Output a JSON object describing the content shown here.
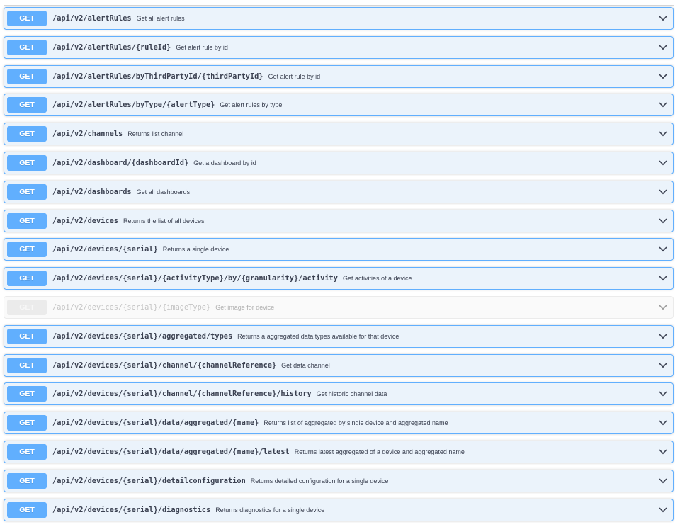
{
  "accent": "#61affe",
  "operations": [
    {
      "method": "GET",
      "path": "/api/v2/alertRules",
      "summary": "Get all alert rules"
    },
    {
      "method": "GET",
      "path": "/api/v2/alertRules/{ruleId}",
      "summary": "Get alert rule by id"
    },
    {
      "method": "GET",
      "path": "/api/v2/alertRules/byThirdPartyId/{thirdPartyId}",
      "summary": "Get alert rule by id"
    },
    {
      "method": "GET",
      "path": "/api/v2/alertRules/byType/{alertType}",
      "summary": "Get alert rules by type"
    },
    {
      "method": "GET",
      "path": "/api/v2/channels",
      "summary": "Returns list channel"
    },
    {
      "method": "GET",
      "path": "/api/v2/dashboard/{dashboardId}",
      "summary": "Get a dashboard by id"
    },
    {
      "method": "GET",
      "path": "/api/v2/dashboards",
      "summary": "Get all dashboards"
    },
    {
      "method": "GET",
      "path": "/api/v2/devices",
      "summary": "Returns the list of all devices"
    },
    {
      "method": "GET",
      "path": "/api/v2/devices/{serial}",
      "summary": "Returns a single device"
    },
    {
      "method": "GET",
      "path": "/api/v2/devices/{serial}/{activityType}/by/{granularity}/activity",
      "summary": "Get activities of a device"
    },
    {
      "method": "GET",
      "path": "/api/v2/devices/{serial}/{imageType}",
      "summary": "Get image for device",
      "deprecated": true
    },
    {
      "method": "GET",
      "path": "/api/v2/devices/{serial}/aggregated/types",
      "summary": "Returns a aggregated data types available for that device"
    },
    {
      "method": "GET",
      "path": "/api/v2/devices/{serial}/channel/{channelReference}",
      "summary": "Get data channel"
    },
    {
      "method": "GET",
      "path": "/api/v2/devices/{serial}/channel/{channelReference}/history",
      "summary": "Get historic channel data"
    },
    {
      "method": "GET",
      "path": "/api/v2/devices/{serial}/data/aggregated/{name}",
      "summary": "Returns list of aggregated by single device and aggregated name"
    },
    {
      "method": "GET",
      "path": "/api/v2/devices/{serial}/data/aggregated/{name}/latest",
      "summary": "Returns latest aggregated of a device and aggregated name"
    },
    {
      "method": "GET",
      "path": "/api/v2/devices/{serial}/detailconfiguration",
      "summary": "Returns detailed configuration for a single device"
    },
    {
      "method": "GET",
      "path": "/api/v2/devices/{serial}/diagnostics",
      "summary": "Returns diagnostics for a single device"
    }
  ],
  "icons": {
    "expand": "chevron-down-icon"
  }
}
